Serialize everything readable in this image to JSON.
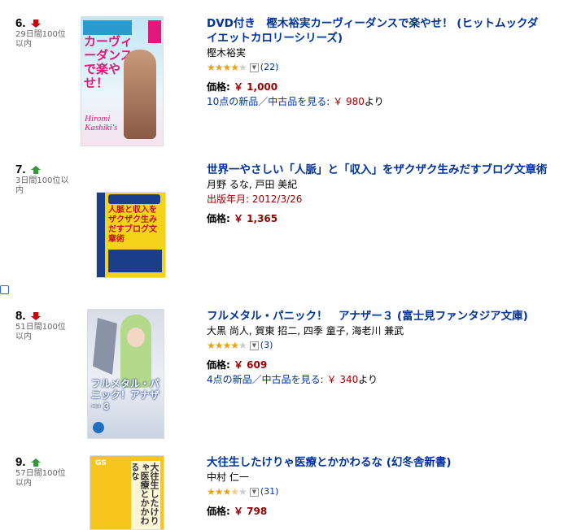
{
  "items": [
    {
      "rank": "6.",
      "trend": "down",
      "days": "29日間100位以内",
      "title": "DVD付き　樫木裕実カーヴィーダンスで楽やせ！ (ヒットムックダイエットカロリーシリーズ)",
      "author": "樫木裕実",
      "rating": 4,
      "review_count": "(22)",
      "price_label": "価格:",
      "price": "￥ 1,000",
      "offers_prefix": "10点の新品／中古品を見る:",
      "offers_price": "￥ 980",
      "offers_suffix": "より",
      "cover_text": "カーヴィーダンスで楽やせ！"
    },
    {
      "rank": "7.",
      "trend": "up",
      "days": "3日間100位以内",
      "title": "世界一やさしい「人脈」と「収入」をザクザク生みだすブログ文章術",
      "author": "月野 るな, 戸田 美紀",
      "date": "出版年月: 2012/3/26",
      "price_label": "価格:",
      "price": "￥ 1,365",
      "cover_text": "人脈と収入をザクザク生みだすブログ文章術"
    },
    {
      "rank": "8.",
      "trend": "down",
      "days": "51日間100位以内",
      "title": "フルメタル・パニック！　アナザー３ (富士見ファンタジア文庫)",
      "author": "大黒 尚人, 賀東 招二, 四季 童子, 海老川 兼武",
      "rating": 4,
      "review_count": "(3)",
      "price_label": "価格:",
      "price": "￥ 609",
      "offers_prefix": "4点の新品／中古品を見る:",
      "offers_price": "￥ 340",
      "offers_suffix": "より",
      "cover_text": "フルメタル・パニック！アナザー 3"
    },
    {
      "rank": "9.",
      "trend": "up",
      "days": "57日間100位以内",
      "title": "大往生したけりゃ医療とかかわるな (幻冬舎新書)",
      "author": "中村 仁一",
      "rating": 3.5,
      "review_count": "(31)",
      "price_label": "価格:",
      "price": "￥ 798",
      "cover_text": "大往生したけりゃ医療とかかわるな"
    }
  ],
  "colors": {
    "link": "#003399",
    "price": "#990000",
    "up": "#339933",
    "down": "#cc0000",
    "star": "#e8a317"
  }
}
